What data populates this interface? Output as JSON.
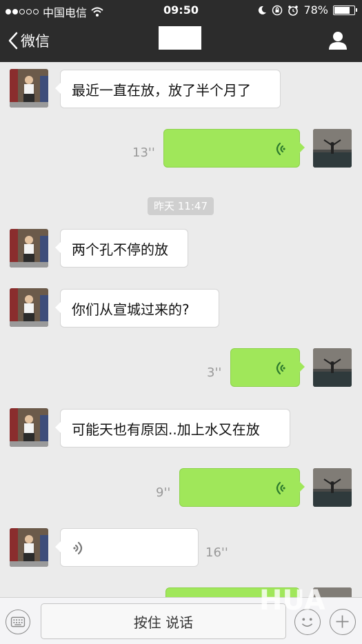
{
  "status_bar": {
    "carrier": "中国电信",
    "time": "09:50",
    "battery": "78%",
    "battery_level": 0.78
  },
  "nav": {
    "back_label": "微信",
    "title": ""
  },
  "colors": {
    "bar_bg": "#2c2c2c",
    "chat_bg": "#ebebeb",
    "outgoing_bubble": "#a0e75a",
    "incoming_bubble": "#ffffff"
  },
  "messages": {
    "m1_text": "最近一直在放，放了半个月了",
    "m2_duration": "13''",
    "timestamp": "昨天 11:47",
    "m3_text": "两个孔不停的放",
    "m4_text": "你们从宣城过来的?",
    "m5_duration": "3''",
    "m6_text": "可能天也有原因..加上水又在放",
    "m7_duration": "9''",
    "m8_duration": "16''"
  },
  "input_bar": {
    "hold_to_talk": "按住 说话"
  },
  "icons": [
    "signal-dots-icon",
    "wifi-icon",
    "moon-icon",
    "lock-rotation-icon",
    "alarm-icon",
    "battery-icon",
    "back-chevron-icon",
    "contact-person-icon",
    "voice-wave-icon",
    "keyboard-icon",
    "emoji-icon",
    "plus-icon"
  ],
  "watermark": "HUA"
}
